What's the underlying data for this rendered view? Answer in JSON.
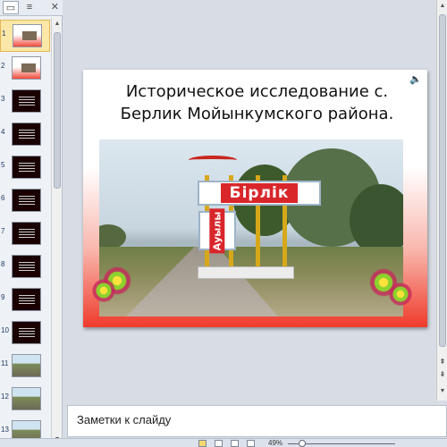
{
  "left_pane": {
    "tabs": [
      {
        "name": "slides-tab",
        "icon": "slides-icon",
        "glyph": "▭"
      },
      {
        "name": "outline-tab",
        "icon": "outline-icon",
        "glyph": "≡"
      }
    ],
    "close_glyph": "✕",
    "thumbnails": [
      {
        "number": "1",
        "style": "t-red"
      },
      {
        "number": "2",
        "style": "t-red"
      },
      {
        "number": "3",
        "style": "t-dark"
      },
      {
        "number": "4",
        "style": "t-dark"
      },
      {
        "number": "5",
        "style": "t-dark"
      },
      {
        "number": "6",
        "style": "t-dark"
      },
      {
        "number": "7",
        "style": "t-dark"
      },
      {
        "number": "8",
        "style": "t-dark"
      },
      {
        "number": "9",
        "style": "t-dark"
      },
      {
        "number": "10",
        "style": "t-dark"
      },
      {
        "number": "11",
        "style": "t-pic"
      },
      {
        "number": "12",
        "style": "t-pic"
      },
      {
        "number": "13",
        "style": "t-pic"
      }
    ],
    "selected_index": 0
  },
  "slide": {
    "title_line1": "Историческое исследование с.",
    "title_line2": "Берлик Мойынкумского района.",
    "speaker_glyph": "🔈",
    "sign_main": "Бірлік",
    "sign_vertical": "Ауылы"
  },
  "notes": {
    "placeholder": "Заметки к слайду"
  },
  "status_bar": {
    "zoom": "49%"
  },
  "colors": {
    "accent_red": "#ee3b2c",
    "selection": "#fbe7a7",
    "sign_red": "#d8262b"
  }
}
